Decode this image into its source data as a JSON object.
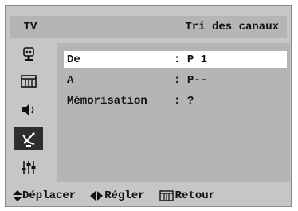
{
  "header": {
    "source": "TV",
    "title": "Tri des canaux"
  },
  "sidebar": {
    "items": [
      {
        "icon": "input-antenna-icon"
      },
      {
        "icon": "picture-icon"
      },
      {
        "icon": "sound-icon"
      },
      {
        "icon": "channel-satellite-icon",
        "active": true
      },
      {
        "icon": "setup-sliders-icon"
      }
    ]
  },
  "menu": {
    "rows": [
      {
        "label": "De",
        "separator": ": ",
        "value": "P 1",
        "selected": true
      },
      {
        "label": "A",
        "separator": ": ",
        "value": "P--",
        "selected": false
      },
      {
        "label": "Mémorisation",
        "separator": ": ",
        "value": "?",
        "selected": false
      }
    ]
  },
  "footer": {
    "move_icon": "up-down-arrows-icon",
    "move_label": "Déplacer",
    "adjust_icon": "left-right-arrows-icon",
    "adjust_label": "Régler",
    "return_icon": "menu-return-icon",
    "return_label": "Retour"
  },
  "colors": {
    "frame": "#c6c6c6",
    "panel": "#b5b5b5",
    "selection": "#ffffff",
    "active_icon_bg": "#2e2e2e"
  }
}
